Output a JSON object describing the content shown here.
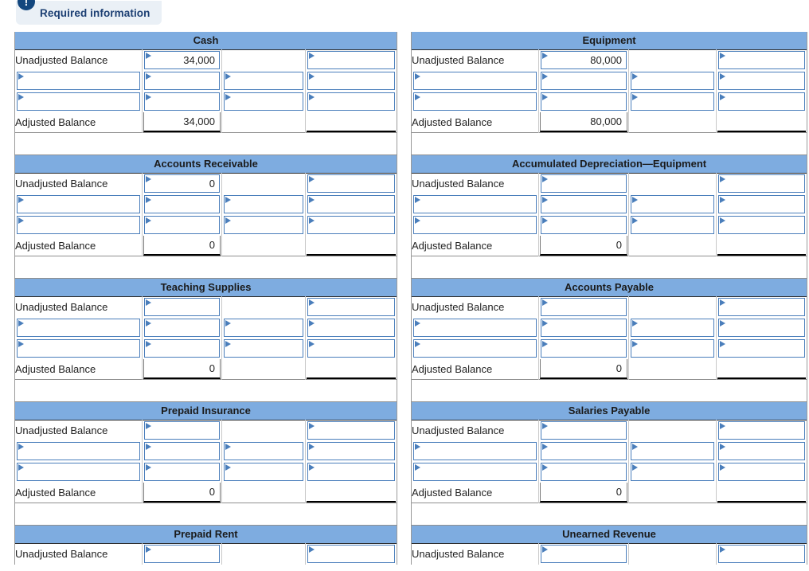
{
  "banner": {
    "icon": "info-exclamation-icon",
    "label": "Required information"
  },
  "row_labels": {
    "unadjusted": "Unadjusted Balance",
    "adjusted": "Adjusted Balance",
    "blank": ""
  },
  "columns": {
    "left": {
      "label_w": 160,
      "c2_w": 100,
      "c3_w": 105,
      "c4_w": 115
    },
    "right": {
      "label_w": 160,
      "c2_w": 113,
      "c3_w": 110,
      "c4_w": 114
    }
  },
  "left_column": [
    {
      "title": "Cash",
      "unadjusted": {
        "c2": "34,000",
        "c3": "",
        "c4": ""
      },
      "middle_rows": 2,
      "adjusted": {
        "c2": "34,000",
        "c3": "",
        "c4": ""
      }
    },
    {
      "title": "Accounts Receivable",
      "unadjusted": {
        "c2": "0",
        "c3": "",
        "c4": ""
      },
      "middle_rows": 2,
      "adjusted": {
        "c2": "0",
        "c3": "",
        "c4": ""
      }
    },
    {
      "title": "Teaching Supplies",
      "unadjusted": {
        "c2": "",
        "c3": "",
        "c4": ""
      },
      "middle_rows": 2,
      "adjusted": {
        "c2": "0",
        "c3": "",
        "c4": ""
      }
    },
    {
      "title": "Prepaid Insurance",
      "unadjusted": {
        "c2": "",
        "c3": "",
        "c4": ""
      },
      "middle_rows": 2,
      "adjusted": {
        "c2": "0",
        "c3": "",
        "c4": ""
      }
    },
    {
      "title": "Prepaid Rent",
      "unadjusted": {
        "c2": "",
        "c3": "",
        "c4": ""
      },
      "middle_rows": 0,
      "adjusted": null
    }
  ],
  "right_column": [
    {
      "title": "Equipment",
      "unadjusted": {
        "c2": "80,000",
        "c3": "",
        "c4": ""
      },
      "middle_rows": 2,
      "adjusted": {
        "c2": "80,000",
        "c3": "",
        "c4": ""
      }
    },
    {
      "title": "Accumulated Depreciation—Equipment",
      "unadjusted": {
        "c2": "",
        "c3": "",
        "c4": ""
      },
      "middle_rows": 2,
      "adjusted": {
        "c2": "0",
        "c3": "",
        "c4": ""
      }
    },
    {
      "title": "Accounts Payable",
      "unadjusted": {
        "c2": "",
        "c3": "",
        "c4": ""
      },
      "middle_rows": 2,
      "adjusted": {
        "c2": "0",
        "c3": "",
        "c4": ""
      }
    },
    {
      "title": "Salaries Payable",
      "unadjusted": {
        "c2": "",
        "c3": "",
        "c4": ""
      },
      "middle_rows": 2,
      "adjusted": {
        "c2": "0",
        "c3": "",
        "c4": ""
      }
    },
    {
      "title": "Unearned Revenue",
      "unadjusted": {
        "c2": "",
        "c3": "",
        "c4": ""
      },
      "middle_rows": 0,
      "adjusted": null
    }
  ],
  "colors": {
    "header_band": "#7eace0",
    "input_border": "#4a7ebb",
    "badge_blue": "#13477e",
    "pill_bg": "#eaf0f6"
  }
}
